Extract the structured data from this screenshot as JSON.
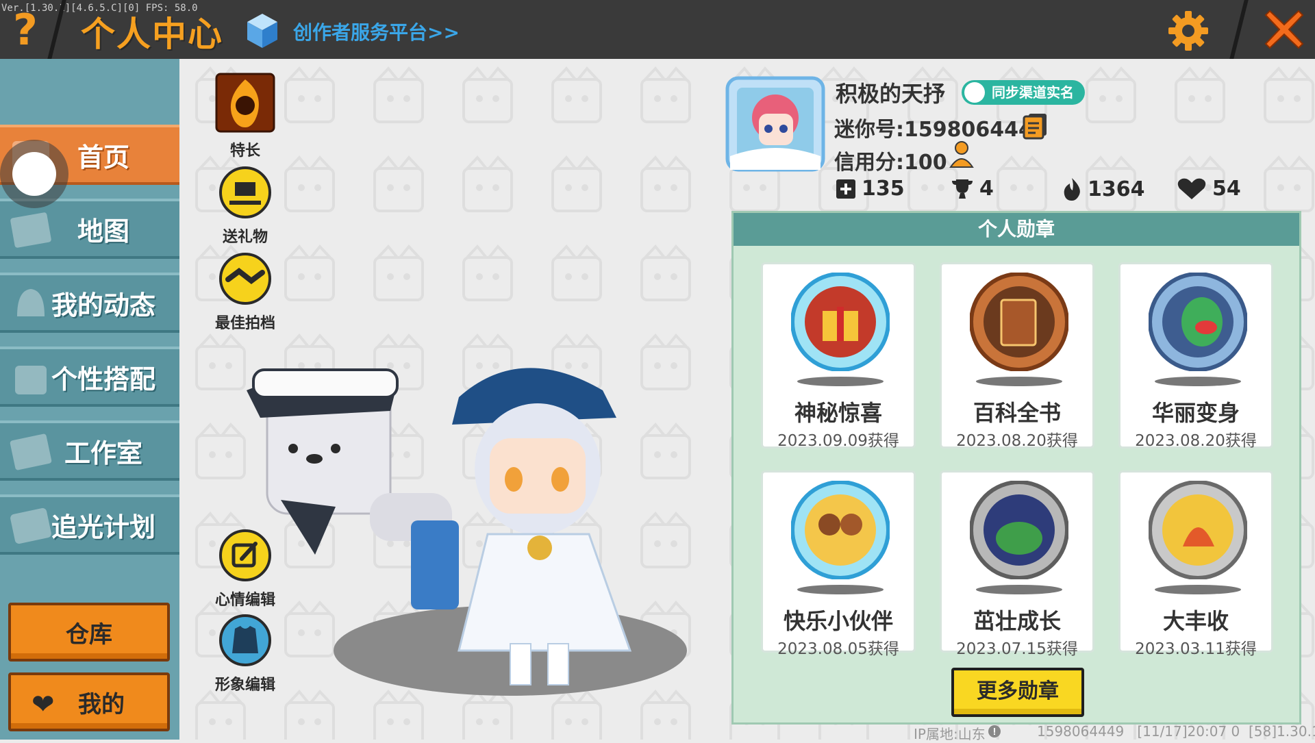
{
  "debug": {
    "version_text": "Ver.[1.30.1][4.6.5.C][0] FPS: 58.0"
  },
  "header": {
    "help_glyph": "?",
    "title": "个人中心",
    "platform_link": "创作者服务平台>>",
    "colors": {
      "title": "#f6a020",
      "link": "#3aa6e8",
      "close": "#f36b1c"
    }
  },
  "sidebar": {
    "items": [
      {
        "label": "首页",
        "active": true
      },
      {
        "label": "地图",
        "active": false
      },
      {
        "label": "我的动态",
        "active": false
      },
      {
        "label": "个性搭配",
        "active": false
      },
      {
        "label": "工作室",
        "active": false
      },
      {
        "label": "追光计划",
        "active": false
      }
    ],
    "warehouse_button": "仓库",
    "mine_button": "我的"
  },
  "actions": {
    "specialty": "特长",
    "send_gift": "送礼物",
    "best_partner": "最佳拍档",
    "mood_edit": "心情编辑",
    "avatar_edit": "形象编辑"
  },
  "profile": {
    "nickname": "积极的天抒",
    "sync_badge": "同步渠道实名",
    "mini_id": "迷你号:1598064449",
    "credit": "信用分:100",
    "stats": {
      "plus": "135",
      "trophy": "4",
      "fire": "1364",
      "heart": "54"
    }
  },
  "medals": {
    "title": "个人勋章",
    "items": [
      {
        "name": "神秘惊喜",
        "date": "2023.09.09获得",
        "icon": "gift-medal-icon"
      },
      {
        "name": "百科全书",
        "date": "2023.08.20获得",
        "icon": "book-medal-icon"
      },
      {
        "name": "华丽变身",
        "date": "2023.08.20获得",
        "icon": "dino-medal-icon"
      },
      {
        "name": "快乐小伙伴",
        "date": "2023.08.05获得",
        "icon": "friends-medal-icon"
      },
      {
        "name": "茁壮成长",
        "date": "2023.07.15获得",
        "icon": "frog-medal-icon"
      },
      {
        "name": "大丰收",
        "date": "2023.03.11获得",
        "icon": "harvest-medal-icon"
      }
    ],
    "more_button": "更多勋章"
  },
  "footer": {
    "ip_location": "IP属地:山东",
    "info": "1598064449   [11/17]20:07 0  [58]1.30.1"
  }
}
